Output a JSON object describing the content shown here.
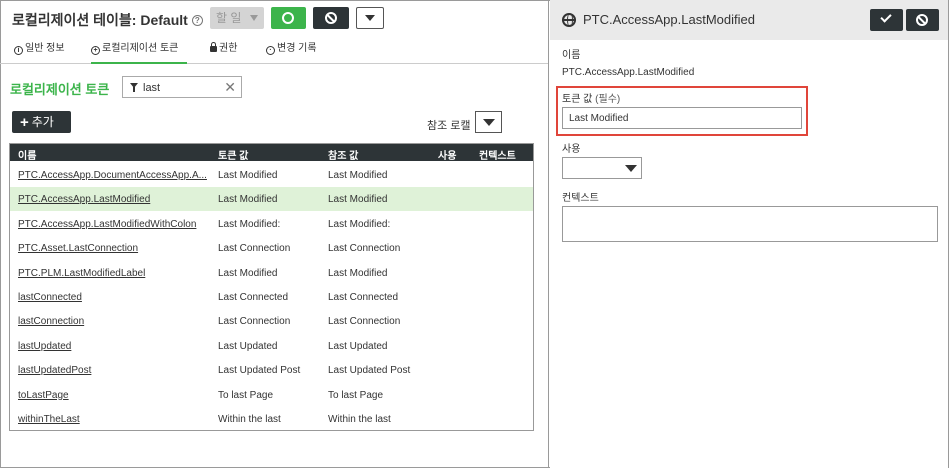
{
  "left": {
    "title": "로컬리제이션 테이블: Default",
    "assign_label": "할 일",
    "tabs": [
      {
        "label": "일반 정보"
      },
      {
        "label": "로컬리제이션 토큰"
      },
      {
        "label": "권한"
      },
      {
        "label": "변경 기록"
      }
    ],
    "section_title": "로컬리제이션 토큰",
    "filter": {
      "value": "last"
    },
    "add_label": "추가",
    "ref_locale_label": "참조 로캘",
    "columns": [
      "이름",
      "토큰 값",
      "참조 값",
      "사용",
      "컨텍스트"
    ],
    "rows": [
      {
        "name": "PTC.AccessApp.DocumentAccessApp.A...",
        "token": "Last Modified",
        "ref": "Last Modified"
      },
      {
        "name": "PTC.AccessApp.LastModified",
        "token": "Last Modified",
        "ref": "Last Modified"
      },
      {
        "name": "PTC.AccessApp.LastModifiedWithColon",
        "token": "Last Modified:",
        "ref": "Last Modified:"
      },
      {
        "name": "PTC.Asset.LastConnection",
        "token": "Last Connection",
        "ref": "Last Connection"
      },
      {
        "name": "PTC.PLM.LastModifiedLabel",
        "token": "Last Modified",
        "ref": "Last Modified"
      },
      {
        "name": "lastConnected",
        "token": "Last Connected",
        "ref": "Last Connected"
      },
      {
        "name": "lastConnection",
        "token": "Last Connection",
        "ref": "Last Connection"
      },
      {
        "name": "lastUpdated",
        "token": "Last Updated",
        "ref": "Last Updated"
      },
      {
        "name": "lastUpdatedPost",
        "token": "Last Updated Post",
        "ref": "Last Updated Post"
      },
      {
        "name": "toLastPage",
        "token": "To last Page",
        "ref": "To last Page"
      },
      {
        "name": "withinTheLast",
        "token": "Within the last",
        "ref": "Within the last"
      }
    ],
    "selected_row": 1,
    "colors": {
      "accent": "#3cb44b",
      "dark": "#2d3437",
      "selected_row": "#dff2d8"
    }
  },
  "right": {
    "title": "PTC.AccessApp.LastModified",
    "name_label": "이름",
    "name_value": "PTC.AccessApp.LastModified",
    "token_label": "토큰 값",
    "required_label": "(필수)",
    "token_value": "Last Modified",
    "use_label": "사용",
    "context_label": "컨텍스트",
    "highlight_color": "#e0453a"
  }
}
